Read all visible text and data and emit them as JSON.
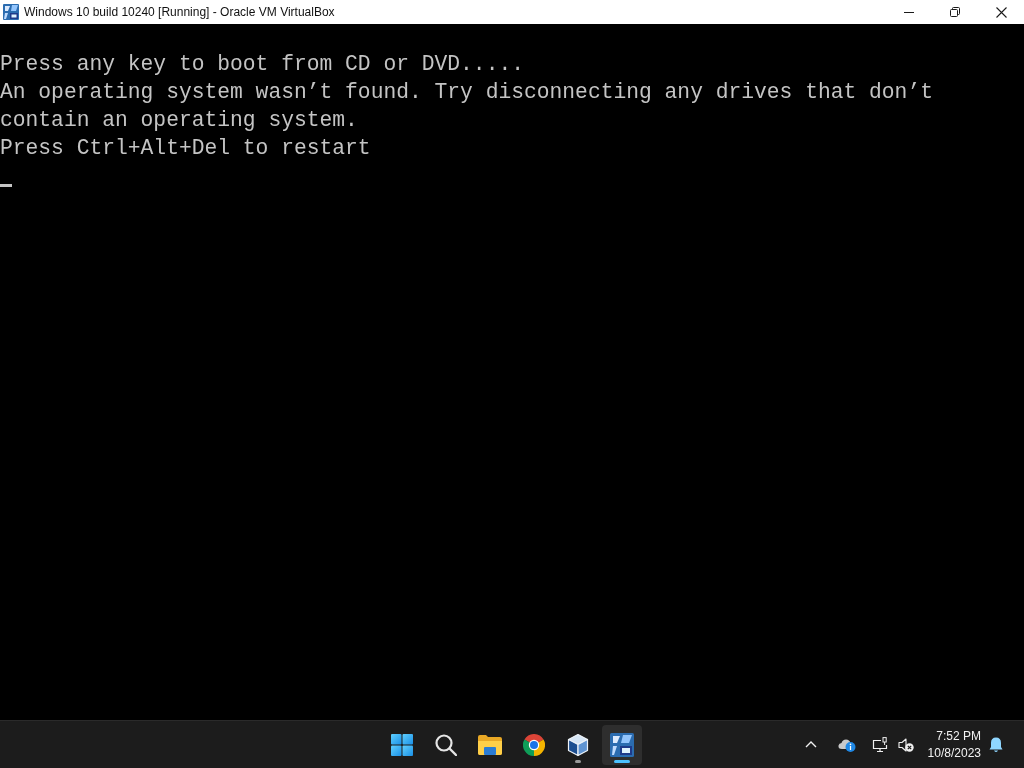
{
  "window": {
    "title": "Windows 10 build 10240 [Running] - Oracle VM VirtualBox"
  },
  "console": {
    "lines": [
      "Press any key to boot from CD or DVD.....",
      "An operating system wasn’t found. Try disconnecting any drives that don’t",
      "contain an operating system.",
      "Press Ctrl+Alt+Del to restart"
    ]
  },
  "taskbar": {
    "items": [
      {
        "kind": "start",
        "open": false,
        "selected": false
      },
      {
        "kind": "search",
        "open": false,
        "selected": false
      },
      {
        "kind": "explorer",
        "open": false,
        "selected": false
      },
      {
        "kind": "browser",
        "open": false,
        "selected": false
      },
      {
        "kind": "virtualbox",
        "open": true,
        "selected": false
      },
      {
        "kind": "vm",
        "open": true,
        "selected": true
      }
    ]
  },
  "tray": {
    "volume_muted": true,
    "time": "7:52 PM",
    "date": "10/8/2023"
  }
}
